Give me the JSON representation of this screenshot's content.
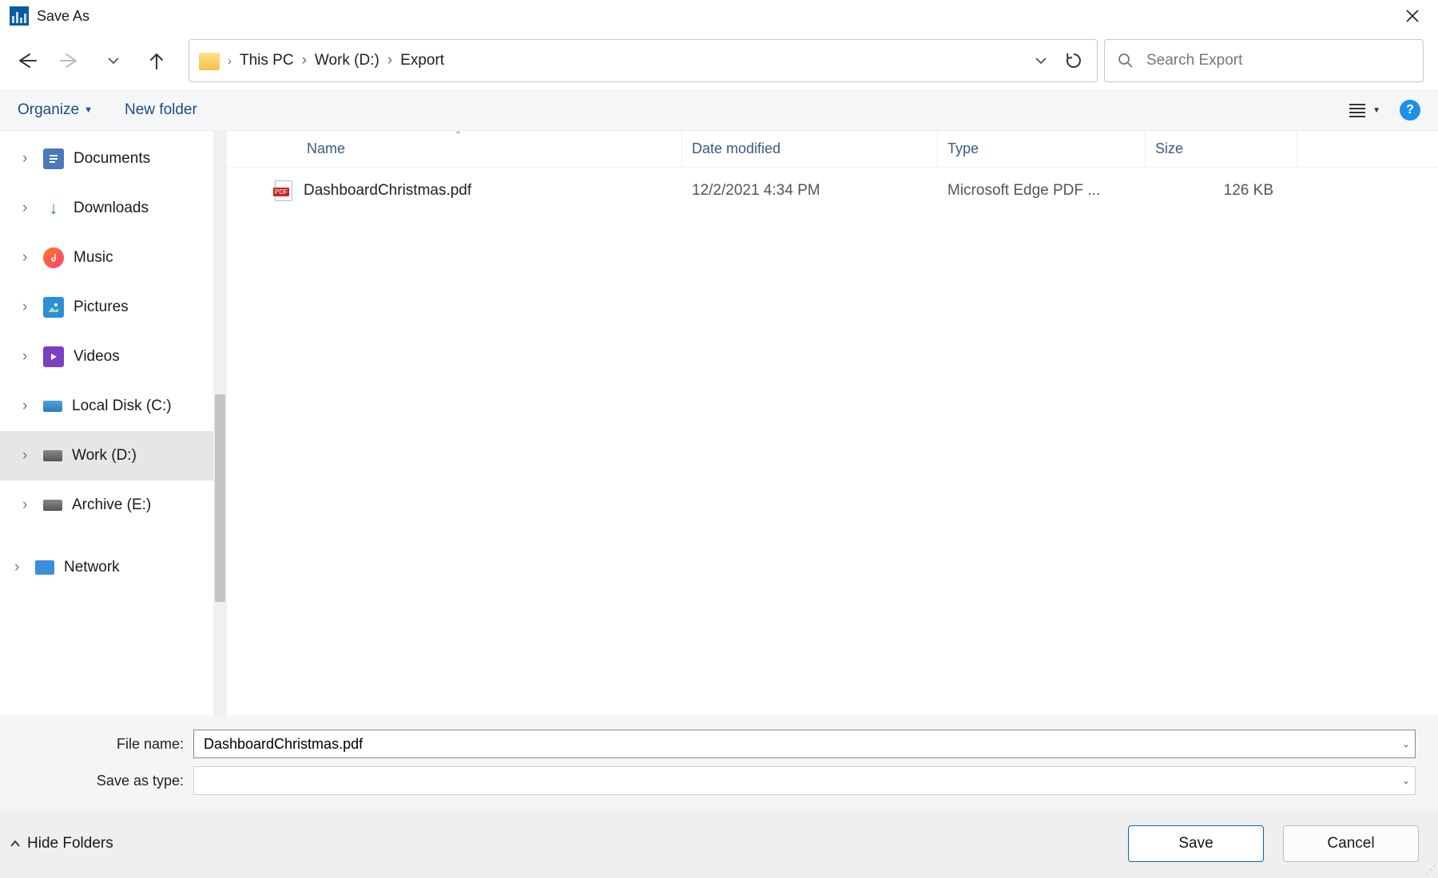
{
  "window": {
    "title": "Save As"
  },
  "breadcrumbs": {
    "root": "This PC",
    "drive": "Work (D:)",
    "folder": "Export"
  },
  "search": {
    "placeholder": "Search Export"
  },
  "toolbar": {
    "organize": "Organize",
    "new_folder": "New folder",
    "help": "?"
  },
  "sidebar": {
    "items": [
      {
        "label": "Documents"
      },
      {
        "label": "Downloads"
      },
      {
        "label": "Music"
      },
      {
        "label": "Pictures"
      },
      {
        "label": "Videos"
      },
      {
        "label": "Local Disk (C:)"
      },
      {
        "label": "Work (D:)"
      },
      {
        "label": "Archive (E:)"
      },
      {
        "label": "Network"
      }
    ]
  },
  "columns": {
    "name": "Name",
    "date": "Date modified",
    "type": "Type",
    "size": "Size"
  },
  "files": [
    {
      "name": "DashboardChristmas.pdf",
      "date": "12/2/2021 4:34 PM",
      "type": "Microsoft Edge PDF ...",
      "size": "126 KB"
    }
  ],
  "inputs": {
    "filename_label": "File name:",
    "filename_value": "DashboardChristmas.pdf",
    "type_label": "Save as type:",
    "type_value": ""
  },
  "actions": {
    "hide_folders": "Hide Folders",
    "save": "Save",
    "cancel": "Cancel"
  }
}
